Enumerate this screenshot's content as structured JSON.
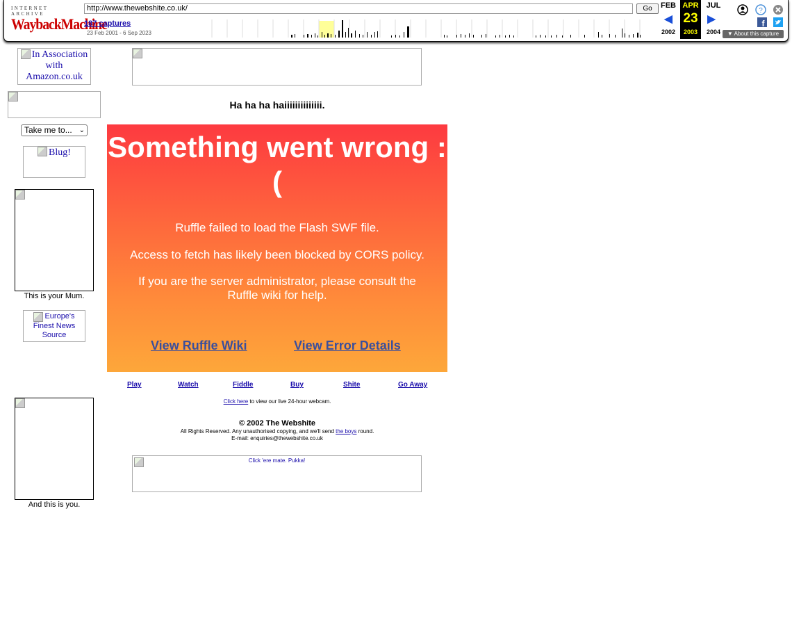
{
  "wayback": {
    "brand_top": "INTERNET ARCHIVE",
    "brand_logo": "WaybackMachine",
    "url": "http://www.thewebshite.co.uk/",
    "go_label": "Go",
    "captures": "187 captures",
    "range": "23 Feb 2001 - 6 Sep 2023",
    "months": {
      "prev": "FEB",
      "cur": "APR",
      "next": "JUL"
    },
    "day": "23",
    "years": {
      "prev": "2002",
      "cur": "2003",
      "next": "2004"
    },
    "about": "About this capture",
    "icons": [
      "user-icon",
      "help-icon",
      "close-icon",
      "facebook-icon",
      "twitter-icon"
    ]
  },
  "sidebar": {
    "amazon_alt": "In Association with Amazon.co.uk",
    "select_value": "Take me to...",
    "blug_alt": "Blug!",
    "mum_caption": "This is your Mum.",
    "news_alt": "Europe's Finest News Source",
    "you_caption": "And this is you."
  },
  "main": {
    "tagline": "Ha ha ha haiiiiiiiiiiiiii.",
    "ruffle": {
      "title": "Something went wrong :(",
      "line1": "Ruffle failed to load the Flash SWF file.",
      "line2": "Access to fetch has likely been blocked by CORS policy.",
      "line3": "If you are the server administrator, please consult the Ruffle wiki for help.",
      "link_wiki": "View Ruffle Wiki",
      "link_details": "View Error Details"
    },
    "nav": [
      "Play",
      "Watch",
      "Fiddle",
      "Buy",
      "Shite",
      "Go Away"
    ],
    "webcam_link": "Click here",
    "webcam_text": " to view our live 24-hour webcam.",
    "copyright": "© 2002 The Webshite",
    "rights_pre": "All Rights Reserved. Any unauthorised copying, and we'll send ",
    "rights_link": "the boys",
    "rights_post": " round.",
    "email": "E-mail: enquiries@thewebshite.co.uk",
    "banner_bottom_alt": "Click 'ere mate. Pukka!"
  },
  "colors": {
    "toolbar_highlight": "#ffff99",
    "ruffle_top": "#fd3a40",
    "ruffle_bottom": "#fda73a",
    "link": "#1a0dab"
  }
}
